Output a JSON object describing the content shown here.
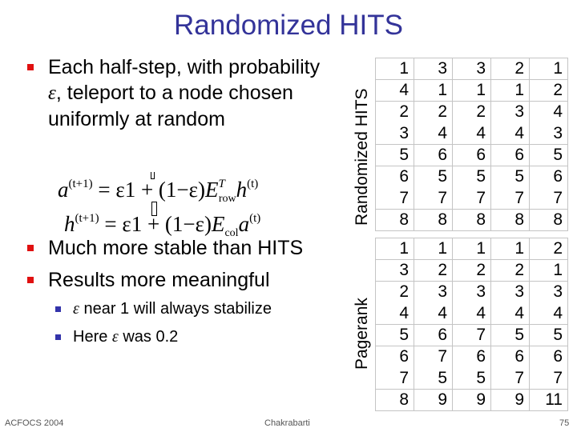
{
  "slide": {
    "title": "Randomized HITS",
    "colors": {
      "title": "#333399",
      "bullet": "#e01010",
      "sub_bullet": "#3333aa",
      "grid": "#c4c4c4"
    }
  },
  "bullets": [
    {
      "line1": "Each half-step, with probability",
      "line2_eps": "ε",
      "line2_rest": ", teleport to a node chosen",
      "line3": "uniformly at random"
    },
    {
      "text": "Much more stable than HITS"
    },
    {
      "text": "Results more meaningful"
    }
  ],
  "sub_bullets": [
    {
      "eps": "ε",
      "text": " near 1 will always stabilize"
    },
    {
      "pre": "Here ",
      "eps": "ε",
      "text": " was 0.2"
    }
  ],
  "formulas": {
    "a": {
      "lhs": "a",
      "lhs_sup": "(t+1)",
      "eq": " = ε1 + (1−ε)",
      "E": "E",
      "E_sup": "T",
      "E_sub": "row",
      "rhs": "h",
      "rhs_sup": "(t)"
    },
    "h": {
      "lhs": "h",
      "lhs_sup": "(t+1)",
      "eq": " = ε1 + (1−ε)",
      "E": "E",
      "E_sub": "col",
      "rhs": "a",
      "rhs_sup": "(t)"
    }
  },
  "tables": {
    "randomized_hits": {
      "label": "Randomized HITS",
      "rows": [
        [
          "1",
          "3",
          "3",
          "2",
          "1"
        ],
        [
          "4",
          "1",
          "1",
          "1",
          "2"
        ],
        [
          "2",
          "2",
          "2",
          "3",
          "4"
        ],
        [
          "3",
          "4",
          "4",
          "4",
          "3"
        ],
        [
          "5",
          "6",
          "6",
          "6",
          "5"
        ],
        [
          "6",
          "5",
          "5",
          "5",
          "6"
        ],
        [
          "7",
          "7",
          "7",
          "7",
          "7"
        ],
        [
          "8",
          "8",
          "8",
          "8",
          "8"
        ]
      ]
    },
    "pagerank": {
      "label": "Pagerank",
      "rows": [
        [
          "1",
          "1",
          "1",
          "1",
          "2"
        ],
        [
          "3",
          "2",
          "2",
          "2",
          "1"
        ],
        [
          "2",
          "3",
          "3",
          "3",
          "3"
        ],
        [
          "4",
          "4",
          "4",
          "4",
          "4"
        ],
        [
          "5",
          "6",
          "7",
          "5",
          "5"
        ],
        [
          "6",
          "7",
          "6",
          "6",
          "6"
        ],
        [
          "7",
          "5",
          "5",
          "7",
          "7"
        ],
        [
          "8",
          "9",
          "9",
          "9",
          "11"
        ]
      ]
    }
  },
  "footer": {
    "left": "ACFOCS 2004",
    "center": "Chakrabarti",
    "page": "75"
  }
}
